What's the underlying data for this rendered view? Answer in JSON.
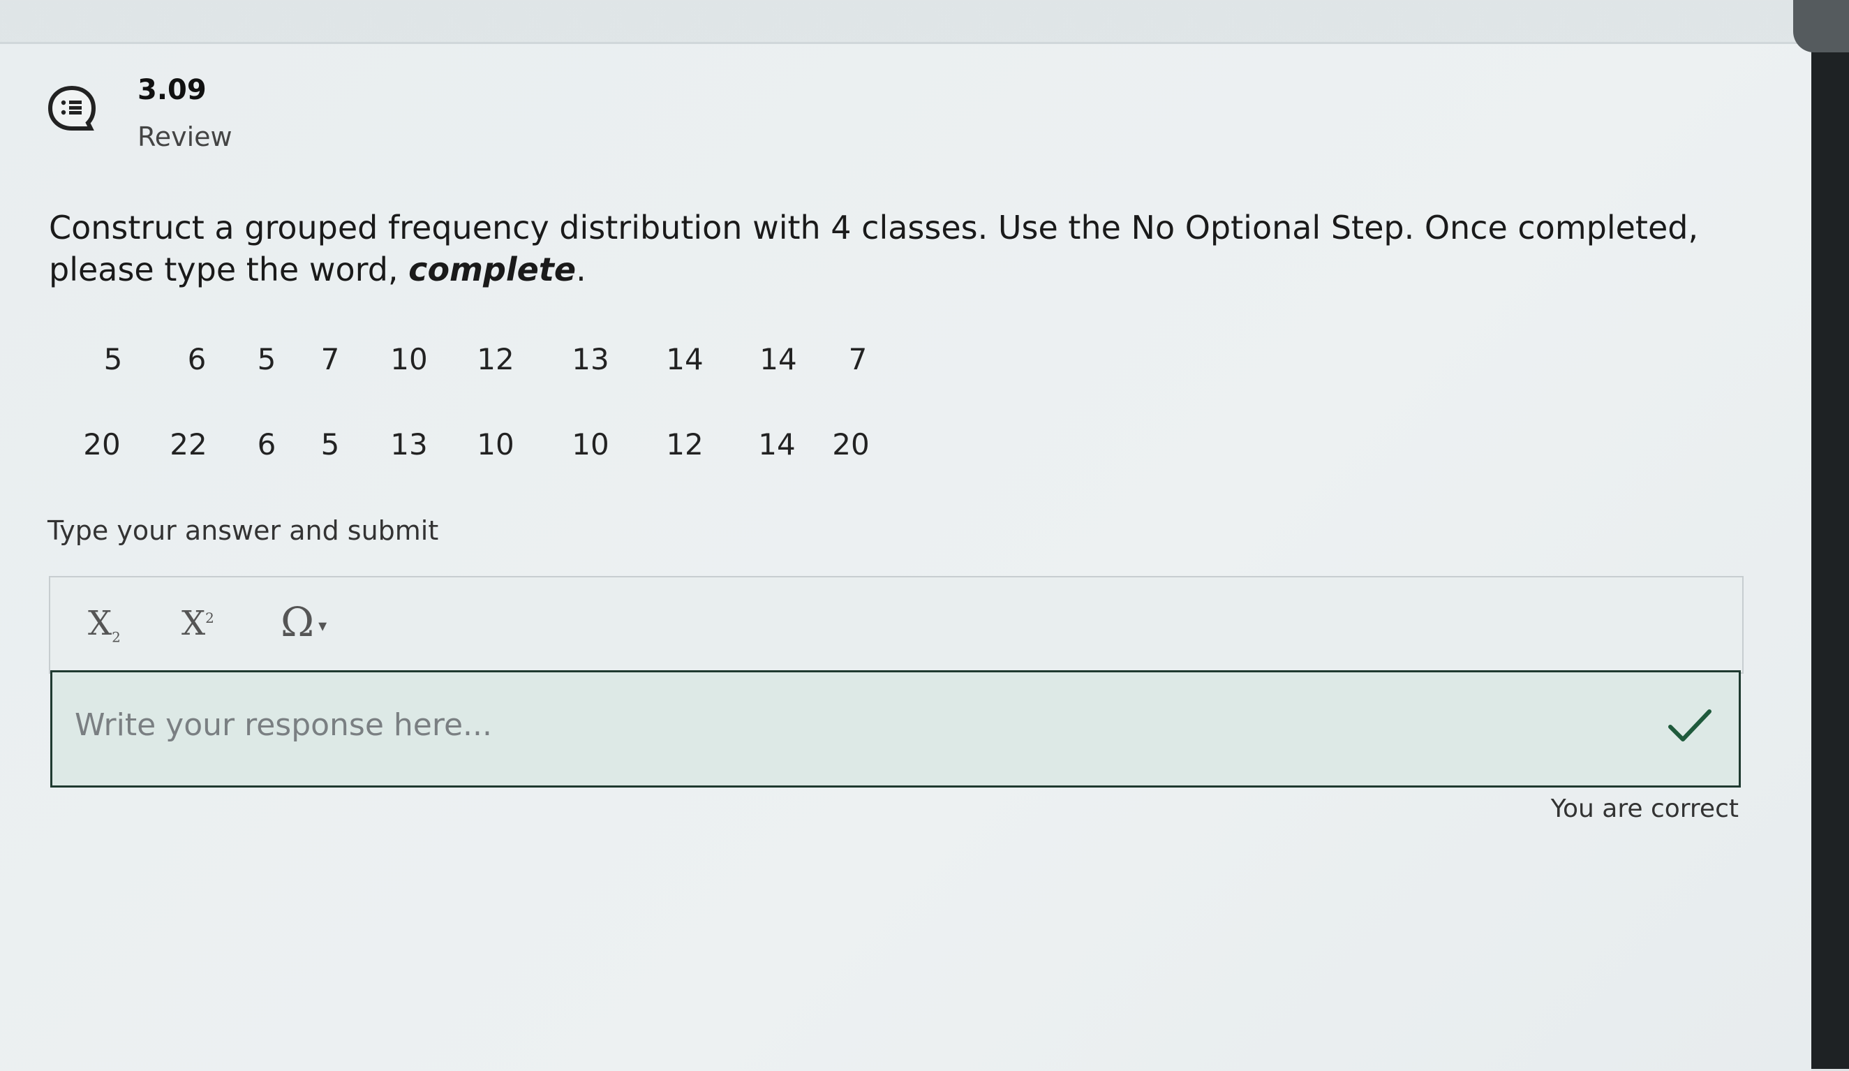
{
  "question": {
    "number": "3.09",
    "type": "Review",
    "prompt_main": "Construct a grouped frequency distribution with 4 classes. Use the No Optional Step. Once completed, please type the word, ",
    "prompt_emphasis": "complete",
    "prompt_end": "."
  },
  "data_values": {
    "row1": [
      "5",
      "6",
      "5",
      "7",
      "10",
      "12",
      "13",
      "14",
      "14",
      "7"
    ],
    "row2": [
      "20",
      "22",
      "6",
      "5",
      "13",
      "10",
      "10",
      "12",
      "14",
      "20"
    ]
  },
  "instruction": "Type your answer and submit",
  "toolbar": {
    "subscript_label": "X",
    "subscript_mark": "2",
    "superscript_label": "X",
    "superscript_mark": "2",
    "special_chars_label": "Ω"
  },
  "answer": {
    "placeholder": "Write your response here...",
    "value": ""
  },
  "feedback": "You are correct",
  "colors": {
    "correct": "#1f5a3c",
    "answer_border": "#1f3a30"
  },
  "icons": {
    "question": "review-list-icon",
    "status": "checkmark-icon",
    "dropdown": "caret-down-icon"
  }
}
